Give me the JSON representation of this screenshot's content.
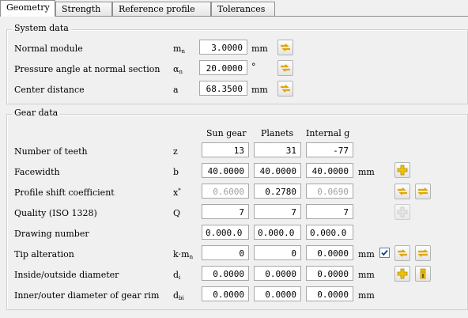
{
  "tabs": [
    "Geometry",
    "Strength",
    "Reference profile",
    "Tolerances"
  ],
  "system": {
    "title": "System data",
    "rows": [
      {
        "label": "Normal module",
        "sym": "m",
        "sub": "n",
        "value": "3.0000",
        "unit": "mm"
      },
      {
        "label": "Pressure angle at normal section",
        "sym": "α",
        "sub": "n",
        "value": "20.0000",
        "unit": "°"
      },
      {
        "label": "Center distance",
        "sym": "a",
        "sub": "",
        "value": "68.3500",
        "unit": "mm"
      }
    ]
  },
  "gear": {
    "title": "Gear data",
    "columns": [
      "Sun gear",
      "Planets",
      "Internal g"
    ],
    "rows": [
      {
        "label": "Number of teeth",
        "sym": "z",
        "values": [
          "13",
          "31",
          "-77"
        ],
        "unit": ""
      },
      {
        "label": "Facewidth",
        "sym": "b",
        "values": [
          "40.0000",
          "40.0000",
          "40.0000"
        ],
        "unit": "mm"
      },
      {
        "label": "Profile shift coefficient",
        "sym": "x",
        "values": [
          "0.6000",
          "0.2780",
          "0.0690"
        ],
        "unit": ""
      },
      {
        "label": "Quality (ISO 1328)",
        "sym": "Q",
        "values": [
          "7",
          "7",
          "7"
        ],
        "unit": ""
      },
      {
        "label": "Drawing number",
        "sym": "",
        "values": [
          "0.000.0",
          "0.000.0",
          "0.000.0"
        ],
        "unit": ""
      },
      {
        "label": "Tip alteration",
        "sym": "k·m",
        "values": [
          "0",
          "0",
          "0.0000"
        ],
        "unit": "mm"
      },
      {
        "label": "Inside/outside diameter",
        "sym": "d",
        "values": [
          "0.0000",
          "0.0000",
          "0.0000"
        ],
        "unit": "mm"
      },
      {
        "label": "Inner/outer diameter of gear rim",
        "sym": "d",
        "values": [
          "0.0000",
          "0.0000",
          "0.0000"
        ],
        "unit": "mm"
      }
    ]
  },
  "tip_alteration_checked": true,
  "colors": {
    "accent": "#f2c200",
    "arrow": "#e0a800"
  }
}
